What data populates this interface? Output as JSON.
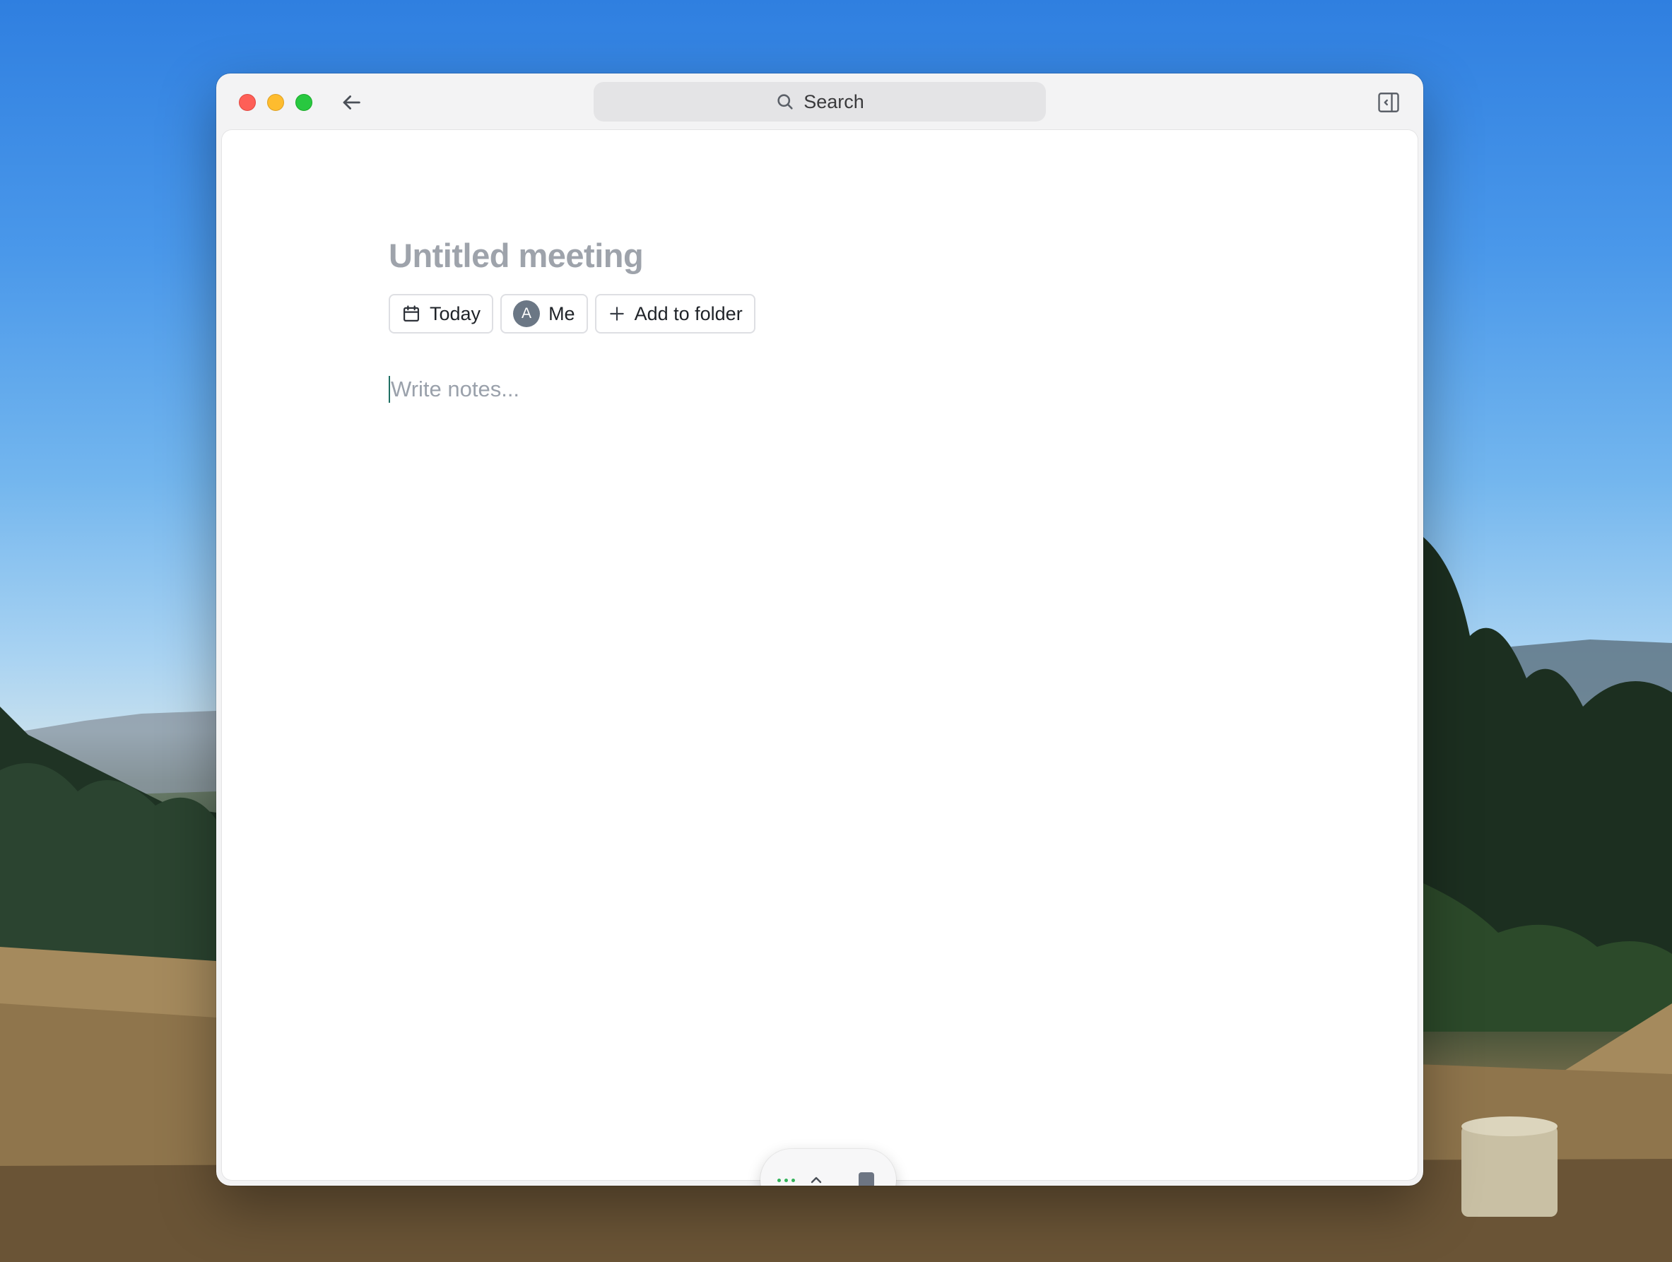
{
  "window": {
    "search": {
      "label": "Search"
    }
  },
  "meeting": {
    "title": "Untitled meeting",
    "chips": {
      "date_label": "Today",
      "attendee_initial": "A",
      "attendee_label": "Me",
      "folder_label": "Add to folder"
    },
    "notes_placeholder": "Write notes..."
  },
  "icons": {
    "back": "arrow-left-icon",
    "search": "magnifier-icon",
    "sidebar": "sidebar-toggle-icon",
    "calendar": "calendar-icon",
    "add": "plus-icon",
    "recording": "recording-dots-icon",
    "expand": "chevron-up-icon",
    "stop": "stop-square-icon"
  },
  "colors": {
    "recording_dots": "#33b35a",
    "title": "#9ea3ab",
    "stop": "#6d7583"
  }
}
